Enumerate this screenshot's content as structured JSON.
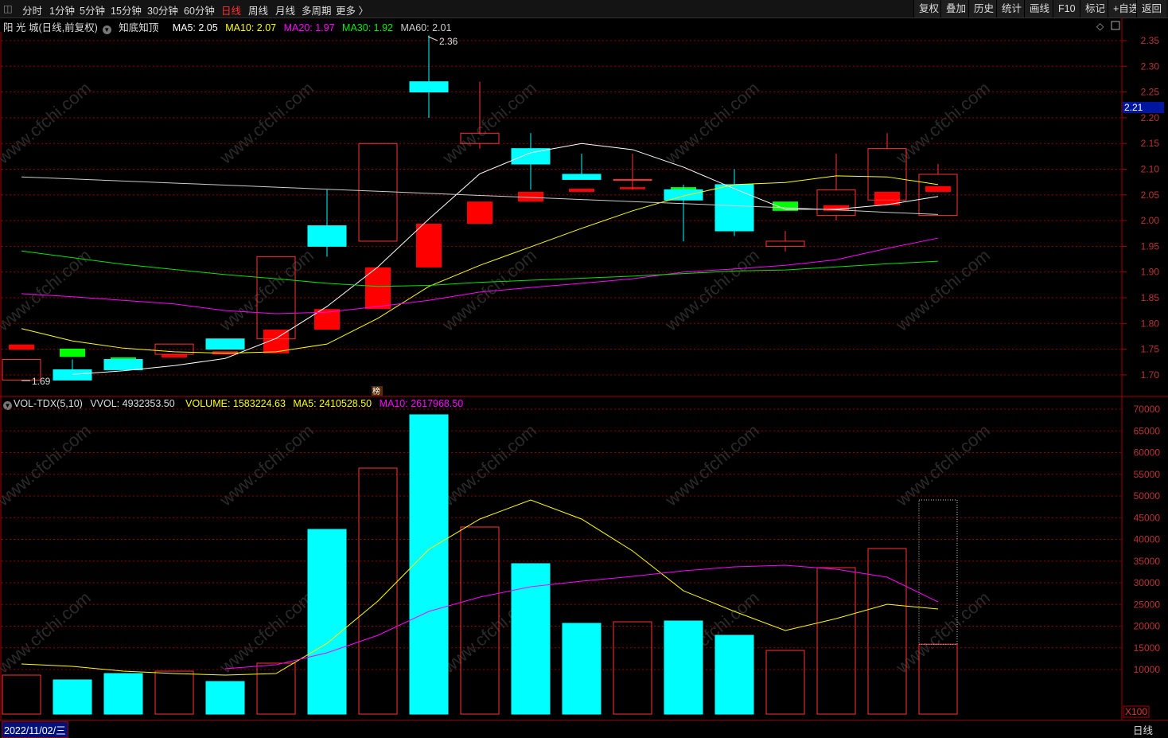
{
  "toolbar": {
    "periods": [
      "分时",
      "1分钟",
      "5分钟",
      "15分钟",
      "30分钟",
      "60分钟",
      "日线",
      "周线",
      "月线",
      "多周期",
      "更多 〉"
    ],
    "active_period": "日线",
    "right_buttons": [
      "复权",
      "叠加",
      "历史",
      "统计",
      "画线",
      "F10",
      "标记",
      "+自选",
      "返回"
    ]
  },
  "info": {
    "stock": "阳 光 城(日线,前复权)",
    "indicator": "知底知顶",
    "ma5": "MA5: 2.05",
    "ma10": "MA10: 2.07",
    "ma20": "MA20: 1.97",
    "ma30": "MA30: 1.92",
    "ma60": "MA60: 2.01"
  },
  "vol_info": {
    "name": "VOL-TDX(5,10)",
    "vvol": "VVOL: 4932353.50",
    "volume": "VOLUME: 1583224.63",
    "ma5": "MA5: 2410528.50",
    "ma10": "MA10: 2617968.50"
  },
  "colors": {
    "up": "#ff3232",
    "down": "#00ffff",
    "ma5": "#ffffff",
    "ma10": "#ffff00",
    "ma20": "#ff00ff",
    "ma30": "#00e600",
    "ma60": "#cccccc",
    "grid": "#8b0000"
  },
  "labels": {
    "high": "2.36",
    "low": "1.69",
    "current_price": "2.21",
    "volume_unit": "X100",
    "badge": "榜",
    "watermark": "www.cfchi.com"
  },
  "bottom": {
    "date": "2022/11/02/三",
    "period": "日线"
  },
  "chart_data": [
    {
      "type": "candlestick",
      "title": "阳光城 日线",
      "ylim": [
        1.68,
        2.38
      ],
      "yticks": [
        "2.35",
        "2.30",
        "2.25",
        "2.20",
        "2.15",
        "2.10",
        "2.05",
        "2.00",
        "1.95",
        "1.90",
        "1.85",
        "1.80",
        "1.75",
        "1.70"
      ],
      "ohlc": [
        [
          1.69,
          1.73,
          1.69,
          1.73
        ],
        [
          1.71,
          1.73,
          1.69,
          1.69
        ],
        [
          1.73,
          1.73,
          1.71,
          1.71
        ],
        [
          1.74,
          1.76,
          1.74,
          1.76
        ],
        [
          1.77,
          1.77,
          1.75,
          1.75
        ],
        [
          1.77,
          1.93,
          1.77,
          1.93
        ],
        [
          1.99,
          2.06,
          1.93,
          1.95
        ],
        [
          1.96,
          2.15,
          1.96,
          2.15
        ],
        [
          2.27,
          2.36,
          2.2,
          2.25
        ],
        [
          2.15,
          2.27,
          2.14,
          2.17
        ],
        [
          2.14,
          2.17,
          2.06,
          2.11
        ],
        [
          2.09,
          2.13,
          2.08,
          2.08
        ],
        [
          2.08,
          2.13,
          2.06,
          2.08
        ],
        [
          2.06,
          2.07,
          1.96,
          2.04
        ],
        [
          2.07,
          2.1,
          1.97,
          1.98
        ],
        [
          1.95,
          1.98,
          1.94,
          1.96
        ],
        [
          2.01,
          2.13,
          2.0,
          2.06
        ],
        [
          2.04,
          2.17,
          2.04,
          2.14
        ],
        [
          2.01,
          2.11,
          2.01,
          2.09
        ]
      ],
      "overlay": [
        [
          1.749,
          1.759
        ],
        [
          1.751,
          1.735
        ],
        [
          1.734,
          1.731
        ],
        [
          1.734,
          1.74
        ],
        [
          1.74,
          1.746
        ],
        [
          1.742,
          1.788
        ],
        [
          1.788,
          1.828
        ],
        [
          1.828,
          1.909
        ],
        [
          1.909,
          1.994
        ],
        [
          1.994,
          2.037
        ],
        [
          2.037,
          2.056
        ],
        [
          2.056,
          2.062
        ],
        [
          2.061,
          2.065
        ],
        [
          2.065,
          2.057
        ],
        [
          2.061,
          2.037
        ],
        [
          2.037,
          2.019
        ],
        [
          2.019,
          2.03
        ],
        [
          2.03,
          2.056
        ],
        [
          2.056,
          2.067
        ]
      ],
      "series": [
        {
          "name": "MA5",
          "values": [
            null,
            1.701,
            1.708,
            1.718,
            1.732,
            1.771,
            1.833,
            1.91,
            2.003,
            2.091,
            2.132,
            2.15,
            2.138,
            2.104,
            2.062,
            2.022,
            2.022,
            2.031,
            2.047
          ]
        },
        {
          "name": "MA10",
          "values": [
            1.79,
            1.766,
            1.752,
            1.745,
            1.742,
            1.745,
            1.76,
            1.81,
            1.872,
            1.913,
            1.949,
            1.985,
            2.019,
            2.048,
            2.07,
            2.074,
            2.087,
            2.085,
            2.07
          ]
        },
        {
          "name": "MA20",
          "values": [
            1.858,
            1.852,
            1.845,
            1.838,
            1.825,
            1.819,
            1.822,
            1.833,
            1.845,
            1.861,
            1.87,
            1.878,
            1.887,
            1.9,
            1.906,
            1.913,
            1.924,
            1.946,
            1.966
          ]
        },
        {
          "name": "MA30",
          "values": [
            1.941,
            1.928,
            1.915,
            1.905,
            1.895,
            1.887,
            1.878,
            1.872,
            1.874,
            1.88,
            1.884,
            1.888,
            1.892,
            1.897,
            1.902,
            1.904,
            1.91,
            1.916,
            1.921
          ]
        },
        {
          "name": "MA60",
          "values": [
            2.085,
            2.081,
            2.077,
            2.073,
            2.069,
            2.065,
            2.061,
            2.057,
            2.053,
            2.049,
            2.045,
            2.041,
            2.037,
            2.033,
            2.029,
            2.025,
            2.021,
            2.016,
            2.012
          ]
        }
      ]
    },
    {
      "type": "bar",
      "title": "VOL-TDX",
      "ylim": [
        5000,
        72000
      ],
      "yticks": [
        "70000",
        "65000",
        "60000",
        "55000",
        "50000",
        "45000",
        "40000",
        "35000",
        "30000",
        "25000",
        "20000",
        "15000",
        "10000"
      ],
      "values": [
        8716,
        7615,
        9083,
        9633,
        7248,
        11468,
        42294,
        56422,
        68716,
        42844,
        34404,
        20642,
        21009,
        21193,
        17890,
        14404,
        33486,
        37890,
        15832
      ],
      "projected_last": 49083,
      "series": [
        {
          "name": "MA5",
          "values": [
            11280,
            10730,
            9630,
            9080,
            8710,
            9080,
            16050,
            25780,
            37700,
            44680,
            49080,
            44680,
            37340,
            28160,
            23390,
            18990,
            21740,
            25040,
            23940
          ]
        },
        {
          "name": "MA10",
          "values": [
            null,
            null,
            null,
            null,
            10180,
            11090,
            13850,
            17890,
            23390,
            26690,
            29080,
            30360,
            31470,
            32750,
            33670,
            34030,
            33120,
            31280,
            25590
          ]
        }
      ]
    }
  ]
}
